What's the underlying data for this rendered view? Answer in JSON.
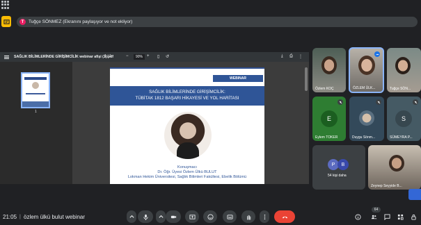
{
  "share_banner": {
    "avatar_letter": "T",
    "text": "Tuğçe SÖNMEZ (Ekranını paylaşıyor ve not ekliyor)"
  },
  "pdf_viewer": {
    "file_title": "SAĞLIK BİLİMLERİNDE GİRİŞİMCİLİK webinar afişi (1).pdf",
    "page_indicator": "1 / 1",
    "zoom": "90%",
    "thumbnail_number": "1"
  },
  "poster": {
    "badge": "WEBINAR",
    "title_line1": "SAĞLIK BİLİMLERİNDE GİRİŞİMCİLİK:",
    "title_line2": "TÜBİTAK 1812 BAŞARI HİKAYESİ VE YOL HARİTASI",
    "speaker_role": "Konuşmacı",
    "speaker_name": "Dr. Öğr. Üyesi Özlem Ülkü BULUT",
    "speaker_affiliation": "Lokman Hekim Üniversitesi, Sağlık Bilimleri Fakültesi, Ebelik Bölümü"
  },
  "participants": [
    {
      "name": "Özlem KOÇ",
      "type": "video"
    },
    {
      "name": "ÖZLEM ÜLK...",
      "type": "video",
      "active": true
    },
    {
      "name": "Tuğçe SÖN...",
      "type": "video"
    },
    {
      "name": "Eylem TOKER",
      "type": "initial",
      "initial": "E",
      "color": "#2e7d32"
    },
    {
      "name": "Duygu Sönm...",
      "type": "photo"
    },
    {
      "name": "SÜMEYRA P...",
      "type": "initial",
      "initial": "S",
      "color": "#455a64"
    },
    {
      "name": "54 kişi daha",
      "type": "more",
      "initials": [
        "P",
        "B"
      ]
    },
    {
      "name": "Zeynep Seyyide B...",
      "type": "video"
    }
  ],
  "bottom_bar": {
    "clock": "21:05",
    "separator": "|",
    "meeting_name": "özlem ülkü bulut webinar",
    "people_count": "64"
  },
  "colors": {
    "poster_blue": "#2f5597",
    "end_call": "#ea4335",
    "present_yellow": "#fbbc04"
  }
}
